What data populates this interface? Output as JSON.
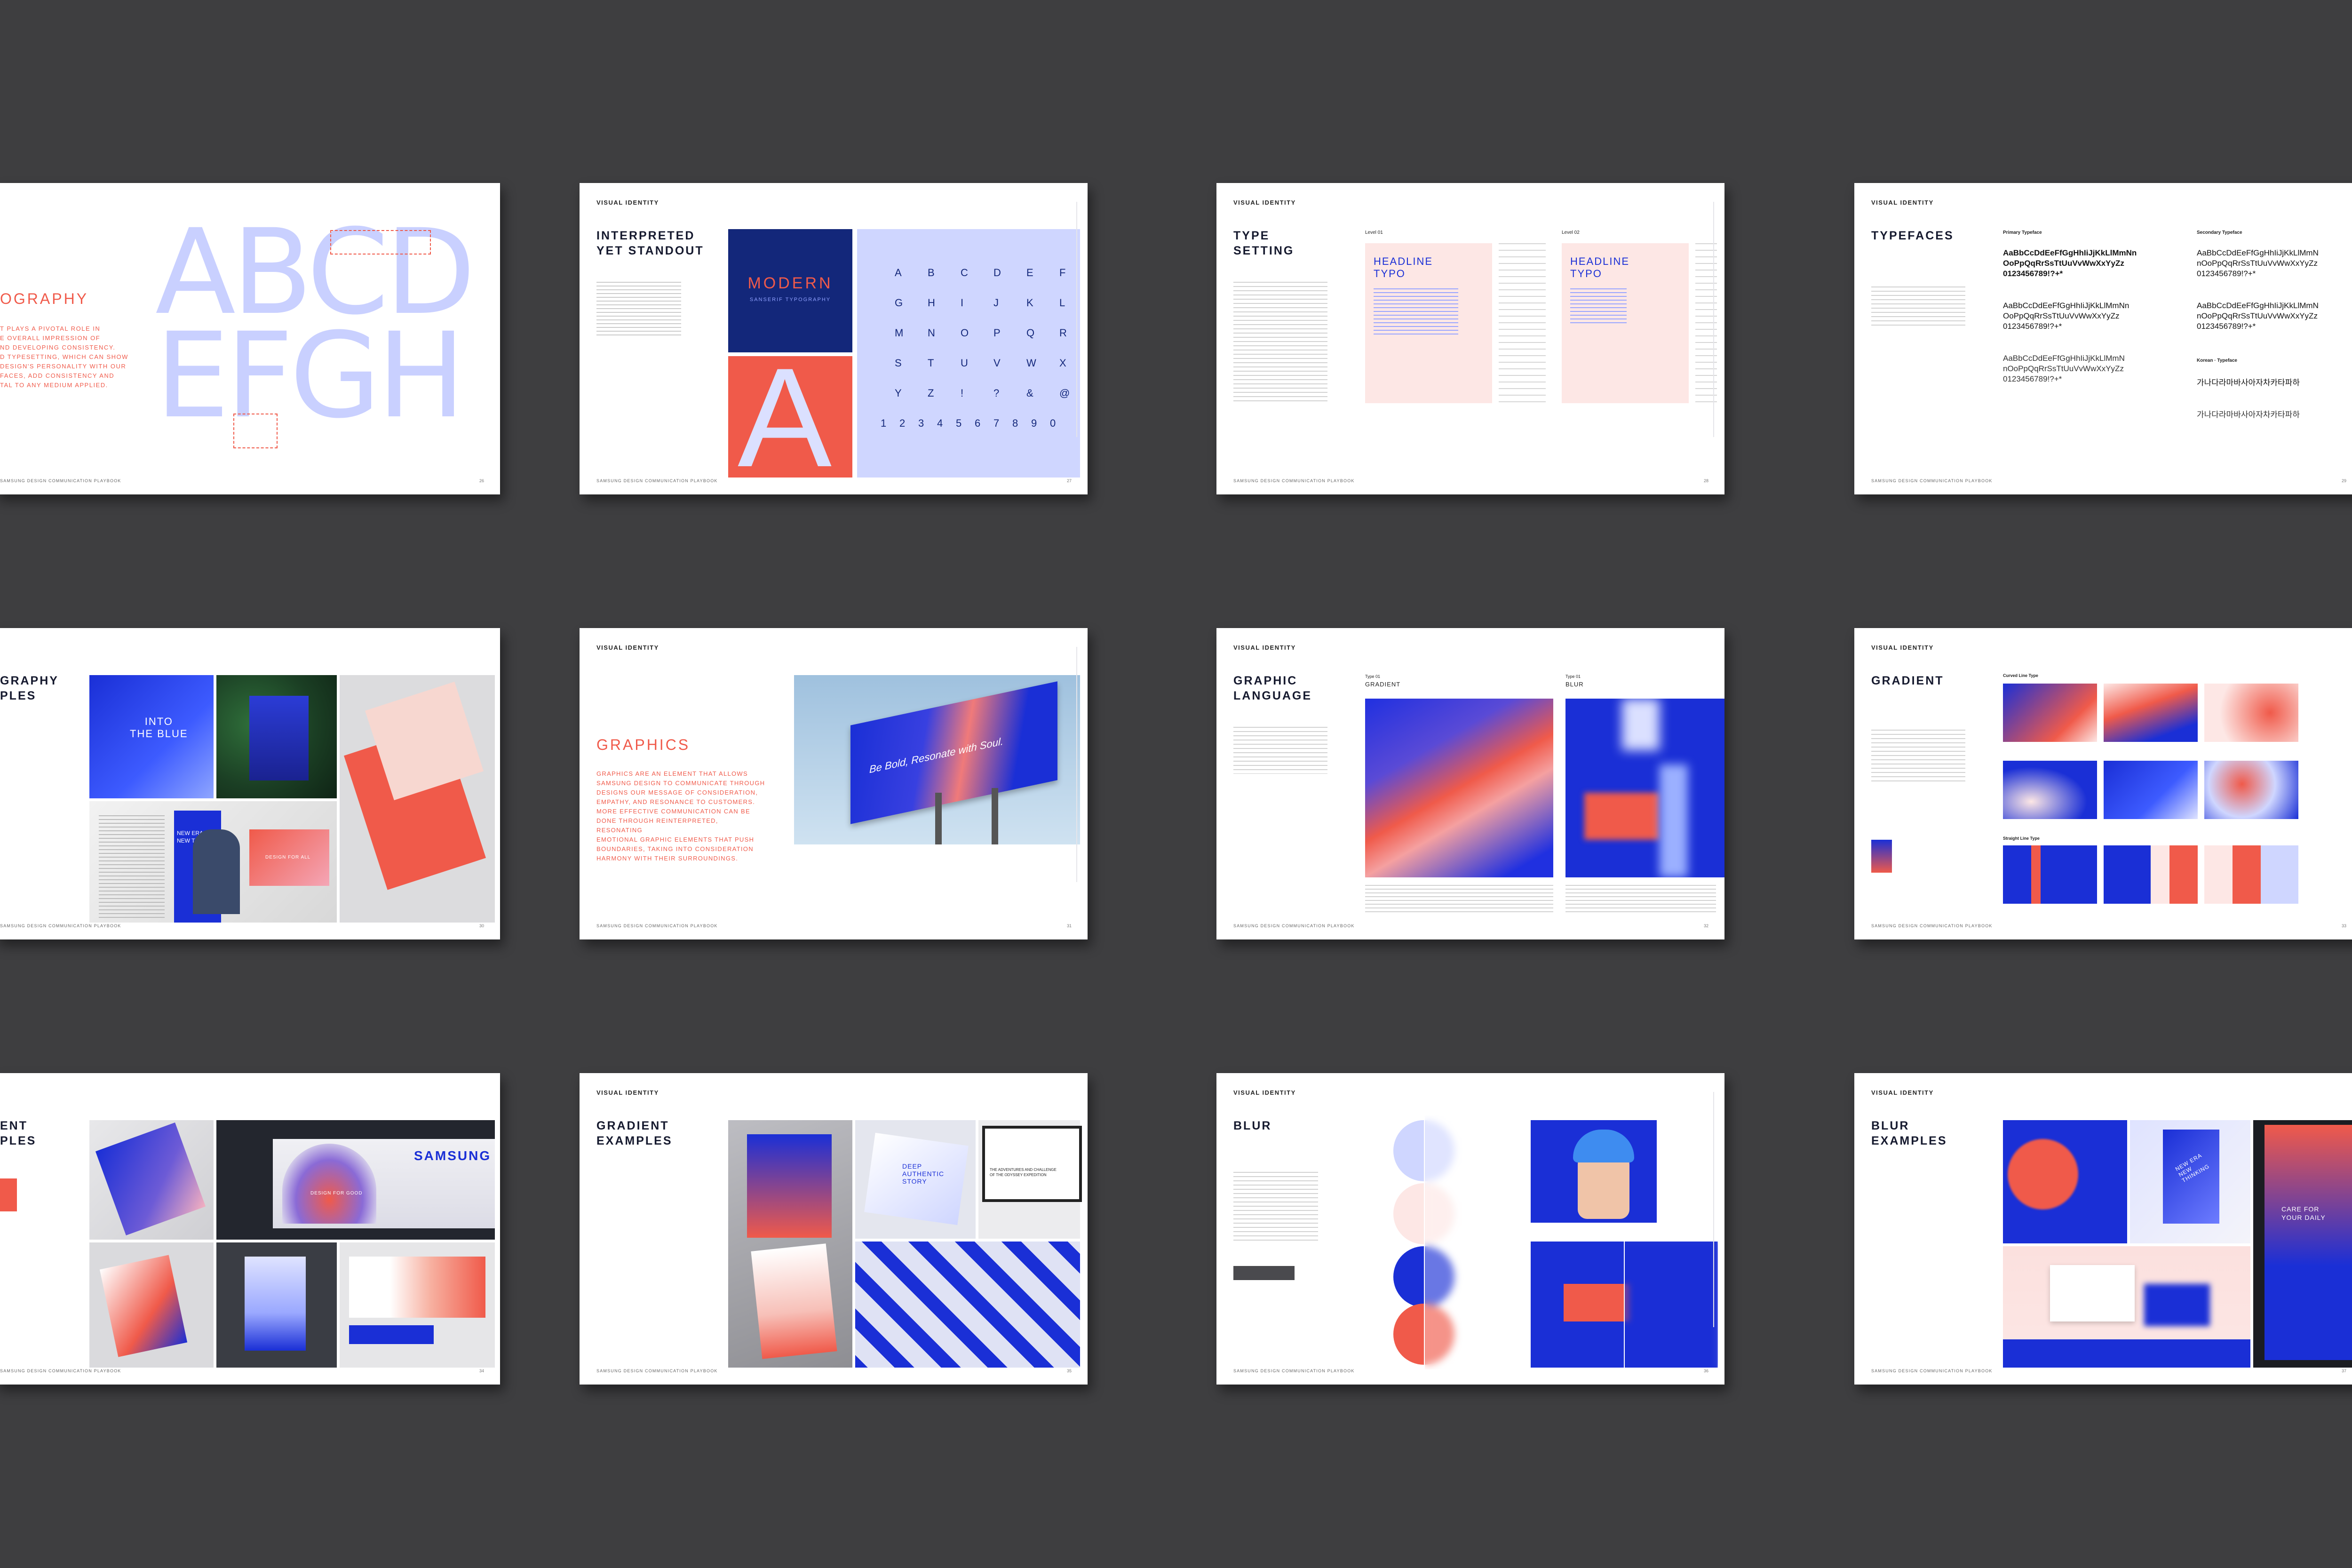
{
  "header": "VISUAL IDENTITY",
  "footer": "SAMSUNG DESIGN COMMUNICATION PLAYBOOK",
  "pages": {
    "typography": {
      "title": "TYPOGRAPHY",
      "title_visible": "OGRAPHY",
      "letters_top": "ABCD",
      "letters_bottom": "EFGH",
      "body": "T PLAYS A PIVOTAL ROLE IN\nE OVERALL IMPRESSION OF\nND DEVELOPING CONSISTENCY.\nD TYPESETTING, WHICH CAN SHOW\nDESIGN'S PERSONALITY WITH OUR\nFACES, ADD CONSISTENCY AND\nTAL TO ANY MEDIUM APPLIED.",
      "page": "26"
    },
    "interpreted": {
      "title": "INTERPRETED\nYET STANDOUT",
      "modern": "MODERN",
      "modern_sub": "SANSERIF TYPOGRAPHY",
      "big_a": "A",
      "grid": [
        "A",
        "B",
        "C",
        "D",
        "E",
        "F",
        "G",
        "H",
        "I",
        "J",
        "K",
        "L",
        "M",
        "N",
        "O",
        "P",
        "Q",
        "R",
        "S",
        "T",
        "U",
        "V",
        "W",
        "X",
        "Y",
        "Z",
        "!",
        "?",
        "&",
        "@",
        "1",
        "2",
        "3",
        "4",
        "5",
        "6",
        "7",
        "8",
        "9",
        "0"
      ],
      "page": "27"
    },
    "type_setting": {
      "title": "TYPE\nSETTING",
      "level1": "Level 01",
      "level2": "Level 02",
      "headline": "HEADLINE\nTYPO",
      "page": "28"
    },
    "typefaces": {
      "title": "TYPEFACES",
      "primary": "Primary Typeface",
      "secondary": "Secondary Typeface",
      "korean": "Korean · Typeface",
      "sample_bold": "AaBbCcDdEeFfGgHhIiJjKkLlMmNn\nOoPpQqRrSsTtUuVvWwXxYyZz\n0123456789!?+*",
      "sample_light": "AaBbCcDdEeFfGgHhIiJjKkLlMmN\nnOoPpQqRrSsTtUuVvWwXxYyZz\n0123456789!?+*",
      "korean_sample": "가나다라마바사아자차카타파하",
      "page": "29"
    },
    "typo_examples": {
      "title": "GRAPHY\nPLES",
      "into_blue": "INTO\nTHE BLUE",
      "new_era": "NEW ERA\nNEW THINKING",
      "design_for_all": "DESIGN FOR ALL",
      "page": "30"
    },
    "graphics": {
      "title": "GRAPHICS",
      "body": "GRAPHICS ARE AN ELEMENT THAT ALLOWS\nSAMSUNG DESIGN TO COMMUNICATE THROUGH\nDESIGNS OUR MESSAGE OF CONSIDERATION,\nEMPATHY, AND RESONANCE TO CUSTOMERS.\nMORE EFFECTIVE COMMUNICATION CAN BE\nDONE THROUGH REINTERPRETED, RESONATING\nEMOTIONAL GRAPHIC ELEMENTS THAT PUSH\nBOUNDARIES, TAKING INTO CONSIDERATION\nHARMONY WITH THEIR SURROUNDINGS.",
      "billboard": "Be Bold, Resonate with Soul.",
      "page": "31"
    },
    "graphic_language": {
      "title": "GRAPHIC\nLANGUAGE",
      "type1": "Type 01",
      "type1_name": "GRADIENT",
      "type2": "Type 01",
      "type2_name": "BLUR",
      "page": "32"
    },
    "gradient": {
      "title": "GRADIENT",
      "curved": "Curved Line Type",
      "straight": "Straight Line Type",
      "page": "33"
    },
    "gradient_ex_left": {
      "title": "ENT\nPLES",
      "samsung": "SAMSUNG",
      "design_good": "DESIGN FOR GOOD",
      "page": "34"
    },
    "gradient_examples": {
      "title": "GRADIENT\nEXAMPLES",
      "deep_story": "DEEP\nAUTHENTIC\nSTORY",
      "adventures": "THE ADVENTURES AND CHALLENGE\nOF THE ODYSSEY EXPEDITION",
      "page": "35"
    },
    "blur": {
      "title": "BLUR",
      "page": "36"
    },
    "blur_examples": {
      "title": "BLUR\nEXAMPLES",
      "new_era": "NEW ERA\nNEW\nTHINKING",
      "care": "CARE FOR\nYOUR DAILY",
      "page": "37"
    }
  },
  "colors": {
    "coral": "#f05a4a",
    "blue": "#1a2fd6",
    "navy": "#13277a",
    "lavender": "#cfd6ff",
    "pink": "#fde7e5"
  }
}
